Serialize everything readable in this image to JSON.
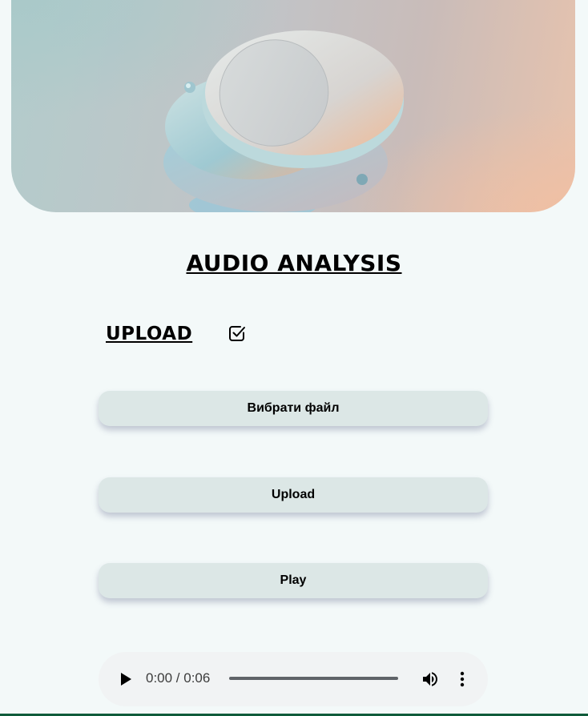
{
  "hero": {
    "image": "abstract-3d-discs-illustration"
  },
  "page": {
    "title": "AUDIO ANALYSIS",
    "upload_heading": "UPLOAD"
  },
  "icons": {
    "check": "checkbox-checked-icon",
    "play": "play-icon",
    "volume": "volume-icon",
    "more": "more-vertical-icon"
  },
  "buttons": {
    "choose_file": "Вибрати файл",
    "upload": "Upload",
    "play": "Play"
  },
  "audio_player": {
    "time": "0:00 / 0:06",
    "progress": 0
  },
  "colors": {
    "background": "#f3f9f9",
    "button": "#dce7e6",
    "player": "#f1f3f4",
    "accent_line": "#0f5b3a"
  }
}
